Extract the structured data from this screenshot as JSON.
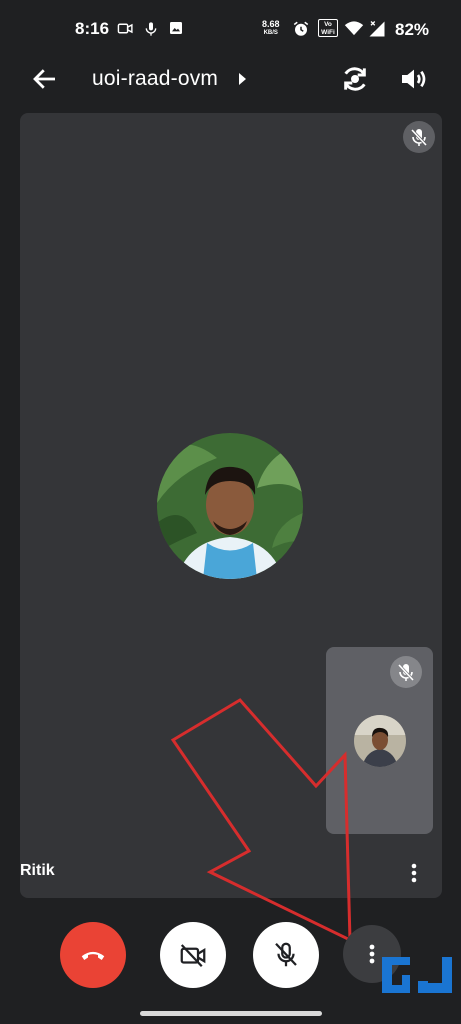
{
  "status_bar": {
    "time": "8:16",
    "net_speed_value": "8.68",
    "net_speed_unit": "KB/S",
    "volte_top": "Vo",
    "volte_bottom": "WiFi",
    "battery": "82%"
  },
  "app_bar": {
    "meeting_code": "uoi-raad-ovm"
  },
  "main_tile": {
    "participant_name": "Ritik"
  },
  "colors": {
    "background": "#1f2022",
    "tile": "#343538",
    "self_tile": "#5f6065",
    "end_call": "#ea4335",
    "annotation": "#d62d2d",
    "watermark": "#1a75d2"
  },
  "icons": [
    "back-arrow-icon",
    "caret-right-icon",
    "switch-camera-icon",
    "speaker-icon",
    "mic-off-icon",
    "more-vert-icon",
    "call-end-icon",
    "camera-off-icon"
  ]
}
